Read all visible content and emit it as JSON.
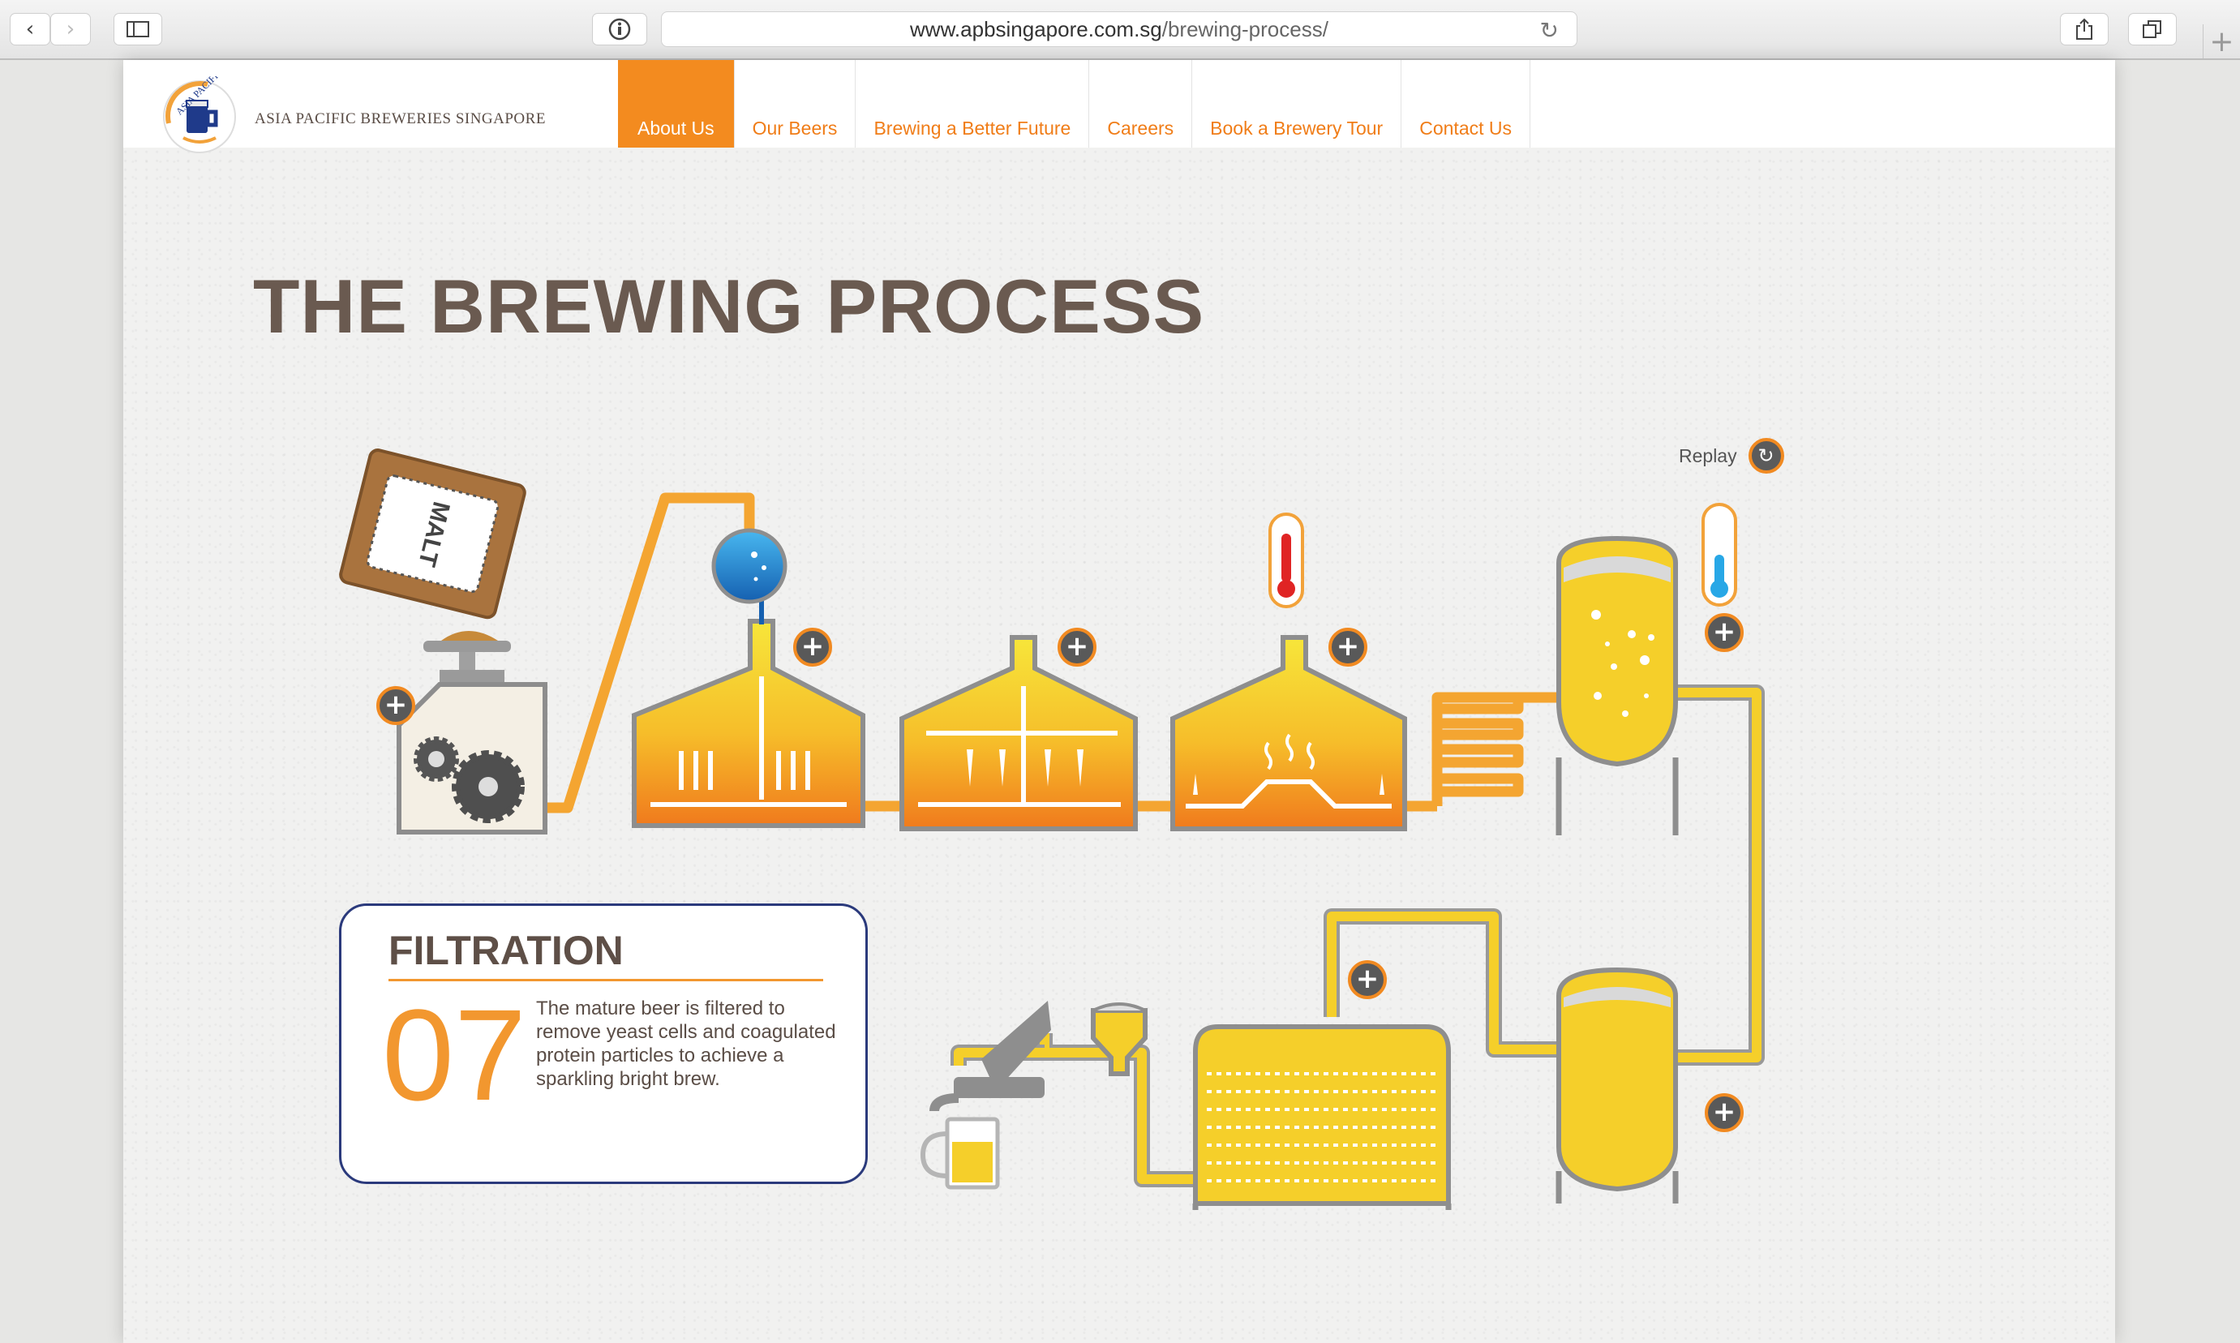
{
  "browser": {
    "url_domain": "www.apbsingapore.com.sg",
    "url_path": "/brewing-process/",
    "back_icon": "chevron-left-icon",
    "forward_icon": "chevron-right-icon",
    "sidebar_icon": "sidebar-icon",
    "info_icon": "info-icon",
    "reload_icon": "reload-icon",
    "share_icon": "share-icon",
    "tabs_icon": "tabs-icon",
    "new_tab_label": "+"
  },
  "site": {
    "logo_text": "ASIA PACIFIC BREWERIES SINGAPORE",
    "logo_arc_text": "ASIA PACIFIC",
    "nav": [
      {
        "label": "About Us",
        "active": true
      },
      {
        "label": "Our Beers",
        "active": false
      },
      {
        "label": "Brewing a Better Future",
        "active": false
      },
      {
        "label": "Careers",
        "active": false
      },
      {
        "label": "Book a Brewery Tour",
        "active": false
      },
      {
        "label": "Contact Us",
        "active": false
      }
    ]
  },
  "main": {
    "title": "THE BREWING PROCESS",
    "replay_label": "Replay",
    "malt_label": "MALT"
  },
  "step": {
    "title": "FILTRATION",
    "number": "07",
    "description": "The mature beer is filtered to remove yeast cells and coagulated protein particles to achieve a sparkling bright brew."
  },
  "colors": {
    "accent_orange": "#f38b1f",
    "beer_yellow": "#f5cf2a",
    "pipe_orange": "#f4a531",
    "steel_grey": "#8e8e8e",
    "card_border": "#2b3a7c",
    "title_brown": "#6a5a50"
  }
}
